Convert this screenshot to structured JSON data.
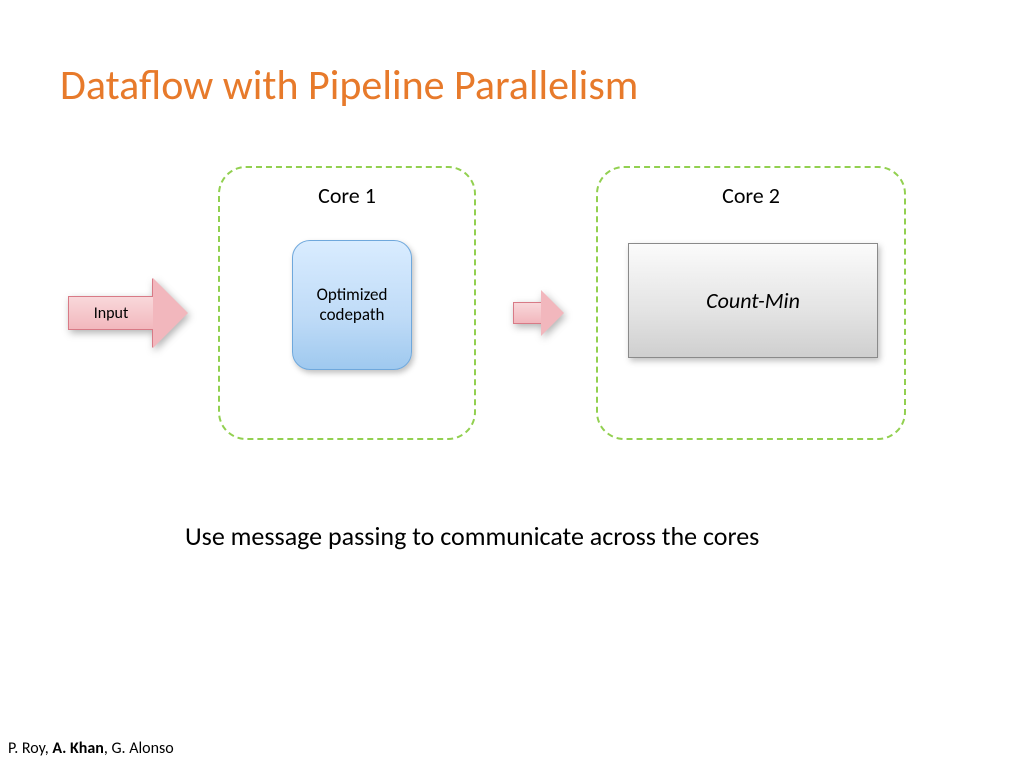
{
  "title": "Dataflow with Pipeline Parallelism",
  "core1_label": "Core 1",
  "core2_label": "Core 2",
  "optimized_label": "Optimized codepath",
  "countmin_label": "Count-Min",
  "input_label": "Input",
  "caption": "Use message passing to communicate across the cores",
  "footer": {
    "a1": "P. Roy, ",
    "a2": "A. Khan",
    "a3": ", G. Alonso"
  }
}
